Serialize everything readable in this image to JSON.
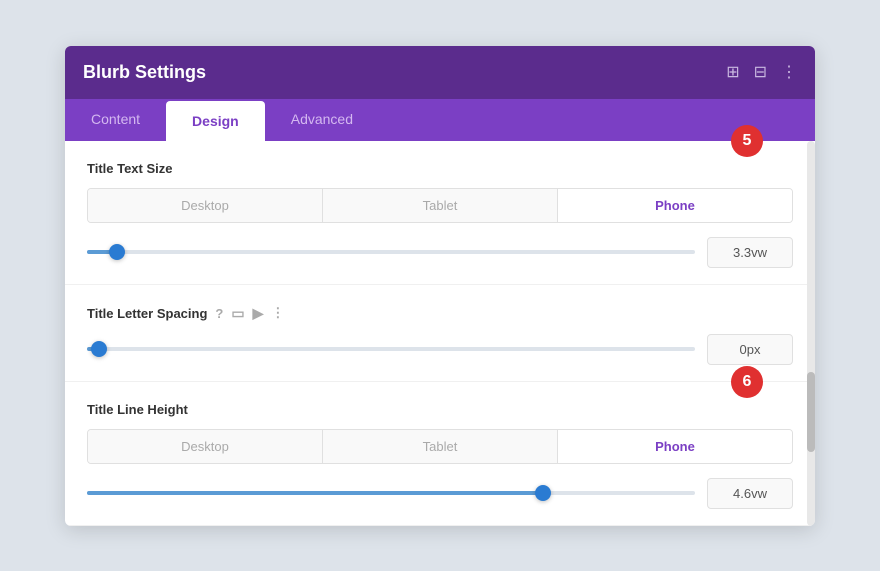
{
  "header": {
    "title": "Blurb Settings",
    "icon_expand": "⊞",
    "icon_columns": "⊟",
    "icon_more": "⋮"
  },
  "tabs": [
    {
      "id": "content",
      "label": "Content",
      "active": false
    },
    {
      "id": "design",
      "label": "Design",
      "active": true
    },
    {
      "id": "advanced",
      "label": "Advanced",
      "active": false
    }
  ],
  "sections": [
    {
      "id": "title-text-size",
      "label": "Title Text Size",
      "badge": "5",
      "badge_color": "#e03030",
      "device_tabs": [
        "Desktop",
        "Tablet",
        "Phone"
      ],
      "active_device": "Phone",
      "slider_position_pct": 5,
      "slider_value": "3.3vw"
    },
    {
      "id": "title-letter-spacing",
      "label": "Title Letter Spacing",
      "has_icons": true,
      "icons": [
        "?",
        "📱",
        "↖",
        "⋮"
      ],
      "slider_position_pct": 2,
      "slider_value": "0px"
    },
    {
      "id": "title-line-height",
      "label": "Title Line Height",
      "badge": "6",
      "badge_color": "#e03030",
      "device_tabs": [
        "Desktop",
        "Tablet",
        "Phone"
      ],
      "active_device": "Phone",
      "slider_position_pct": 75,
      "slider_value": "4.6vw"
    }
  ]
}
